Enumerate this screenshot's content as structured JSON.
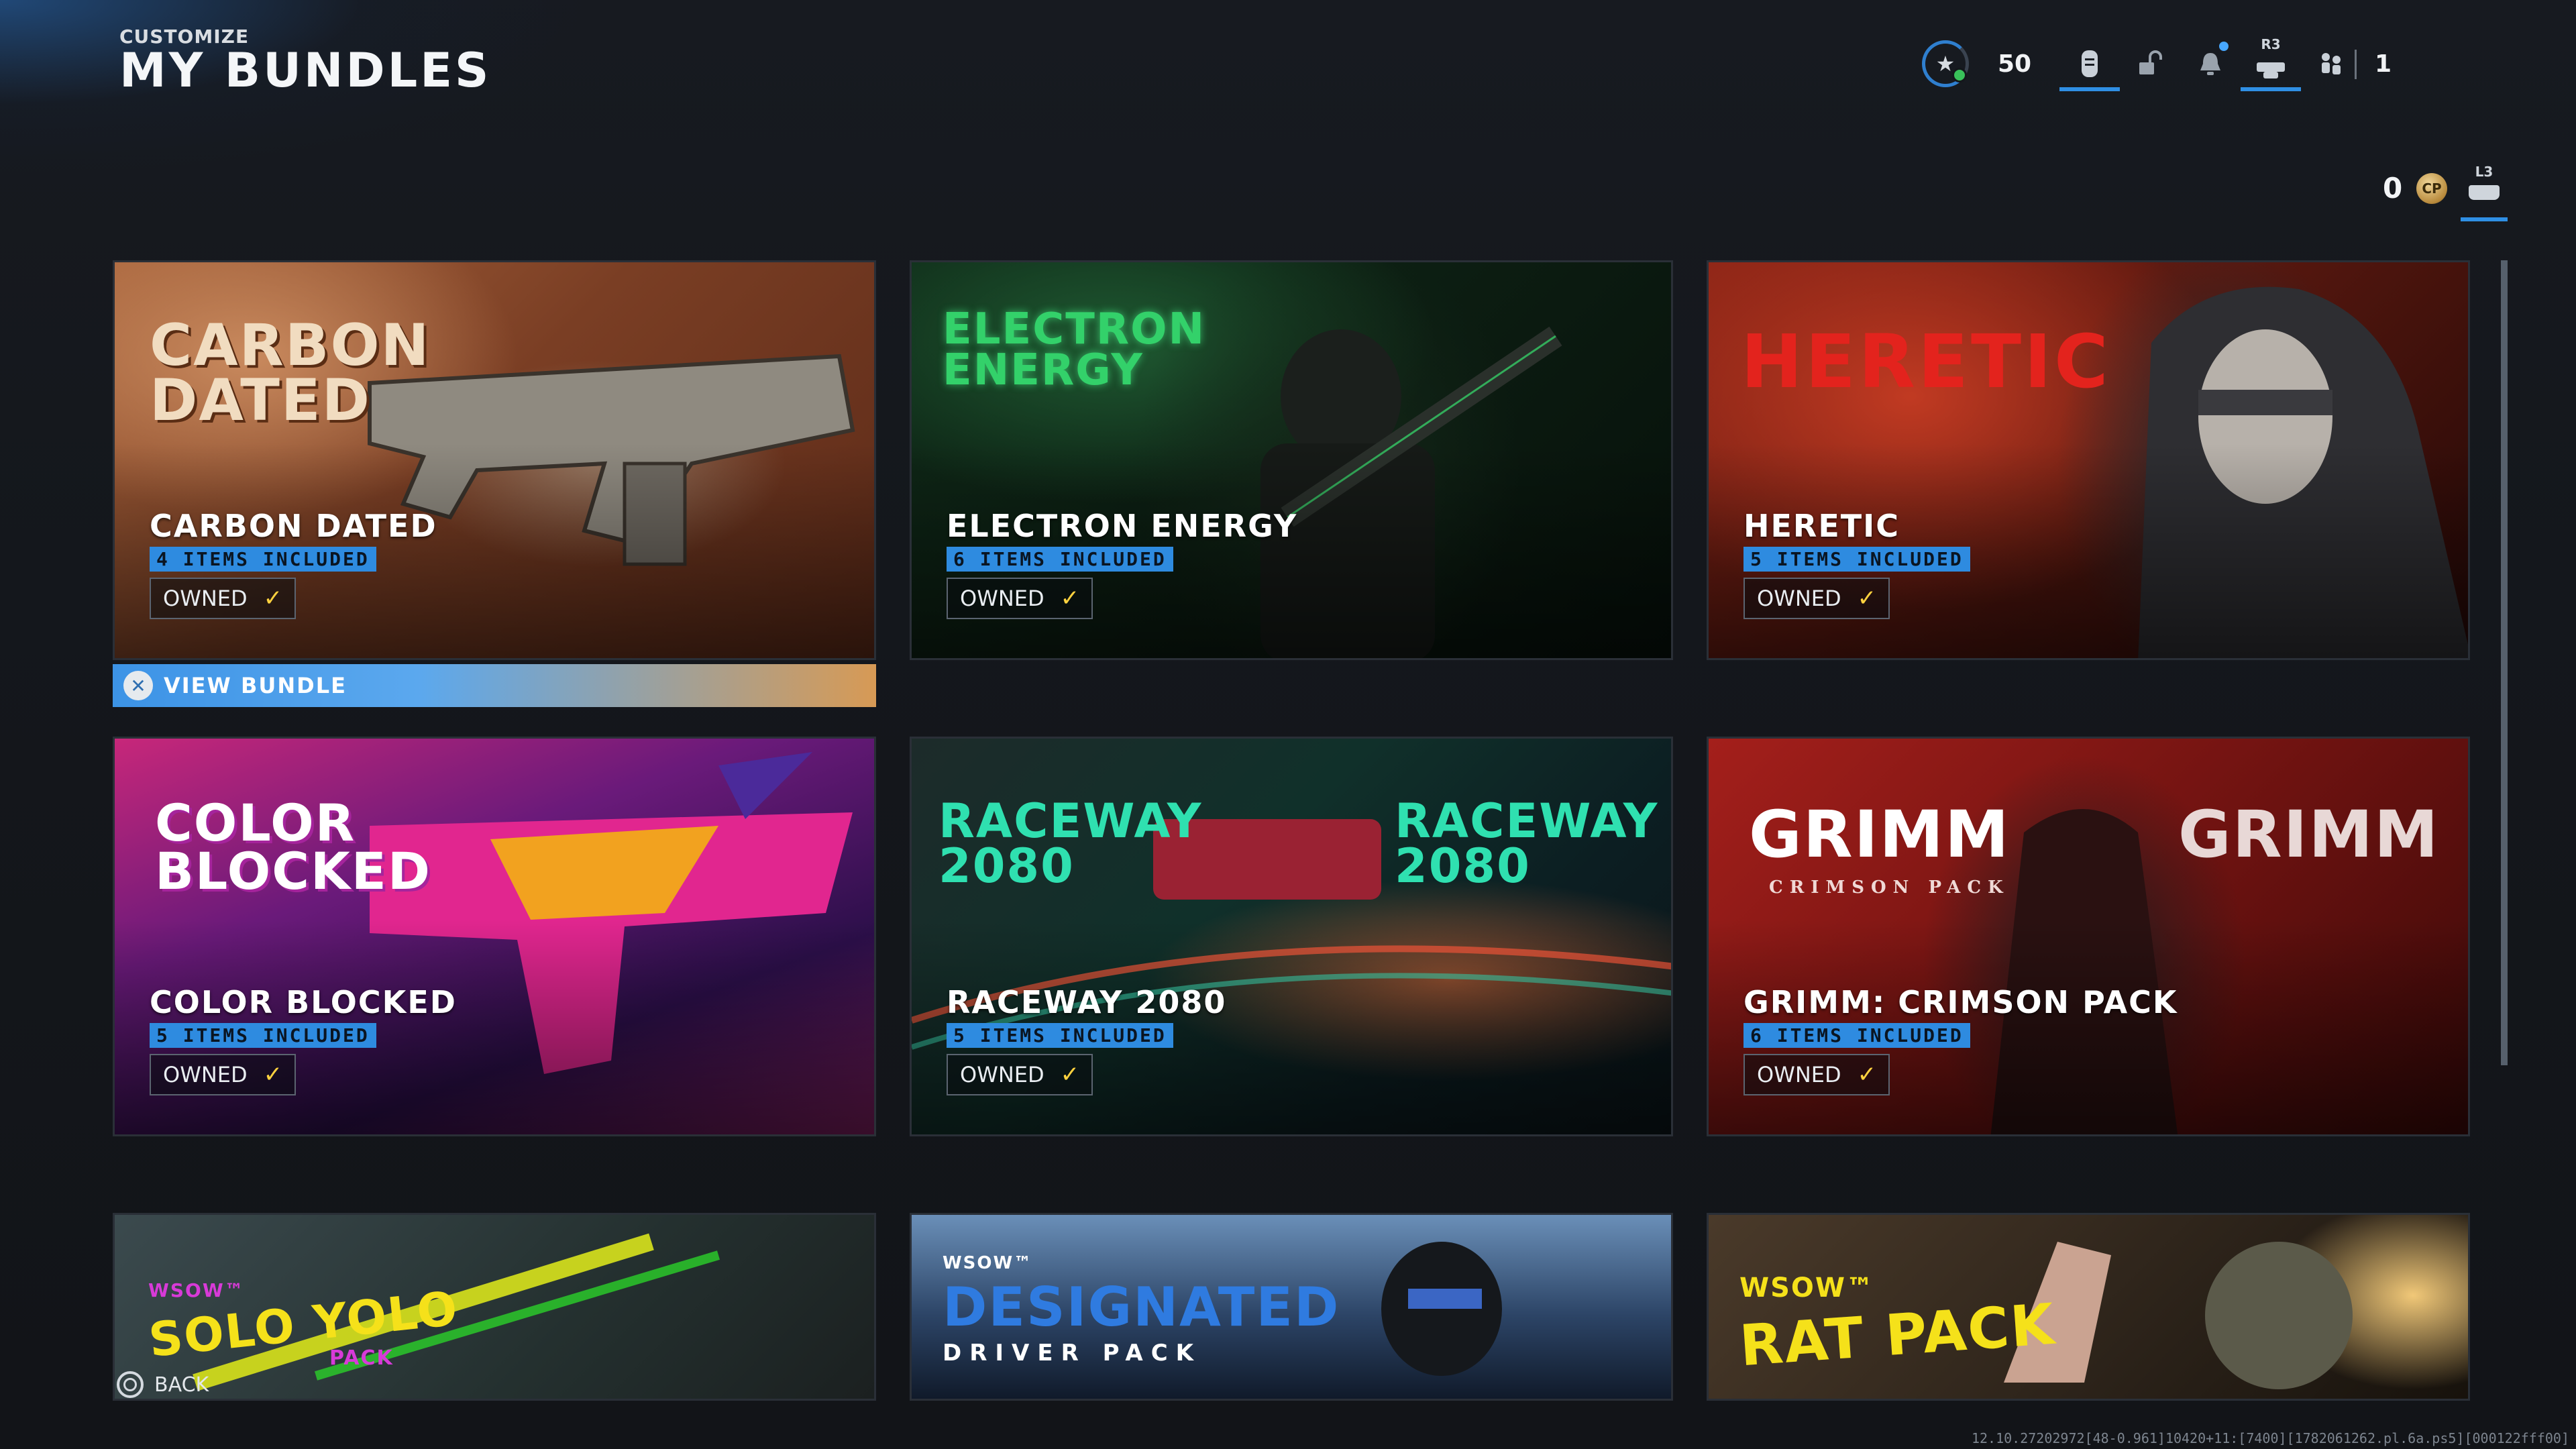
{
  "header": {
    "subtitle": "CUSTOMIZE",
    "title": "MY BUNDLES"
  },
  "topbar": {
    "level": "50",
    "rank_icon": "rank-star-icon",
    "nav_icons": [
      "operator-icon",
      "unlock-icon",
      "notification-bell-icon",
      "controller-r3-icon",
      "squad-icon"
    ],
    "r3_label": "R3",
    "party_count": "1"
  },
  "currency": {
    "cod_points": "0",
    "coin_label": "CP",
    "l3_label": "L3"
  },
  "view_bundle_label": "VIEW BUNDLE",
  "back_label": "BACK",
  "build_string": "12.10.27202972[48-0.961]10420+11:[7400][1782061262.pl.6a.ps5][000122fff00]",
  "bundles": [
    {
      "logo": "CARBON DATED",
      "name": "CARBON DATED",
      "items": "4 ITEMS INCLUDED",
      "status": "OWNED"
    },
    {
      "logo": "ELECTRON ENERGY",
      "name": "ELECTRON ENERGY",
      "items": "6 ITEMS INCLUDED",
      "status": "OWNED"
    },
    {
      "logo": "HERETIC",
      "name": "HERETIC",
      "items": "5 ITEMS INCLUDED",
      "status": "OWNED"
    },
    {
      "logo": "COLOR BLOCKED",
      "name": "COLOR BLOCKED",
      "items": "5 ITEMS INCLUDED",
      "status": "OWNED"
    },
    {
      "logo": "RACEWAY 2080",
      "name": "RACEWAY 2080",
      "items": "5 ITEMS INCLUDED",
      "status": "OWNED"
    },
    {
      "logo": "GRIMM",
      "logo_sub": "CRIMSON PACK",
      "name": "GRIMM: CRIMSON PACK",
      "items": "6 ITEMS INCLUDED",
      "status": "OWNED"
    },
    {
      "logo": "SOLO YOLO",
      "logo_sub": "PACK",
      "logo_brand": "WSOW™"
    },
    {
      "logo": "DESIGNATED",
      "logo_sub": "DRIVER PACK",
      "logo_brand": "WSOW™"
    },
    {
      "logo": "RAT PACK",
      "logo_brand": "WSOW™"
    }
  ],
  "colors": {
    "accent": "#2e8be0",
    "owned_check": "#ffd23f",
    "background": "#14171c"
  }
}
